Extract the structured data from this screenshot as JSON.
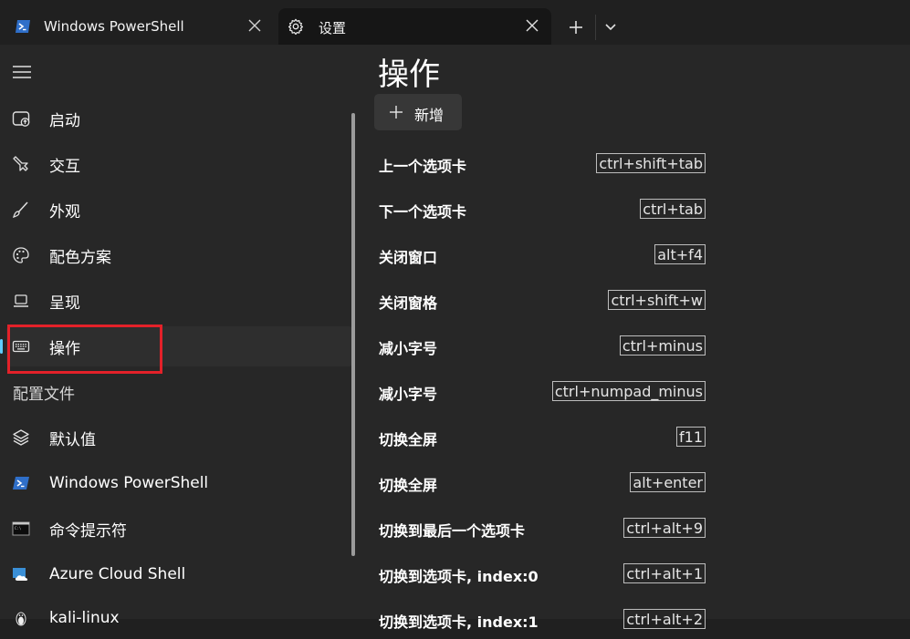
{
  "tabs": [
    {
      "title": "Windows PowerShell",
      "icon": "powershell-icon",
      "active": false
    },
    {
      "title": "设置",
      "icon": "gear-icon",
      "active": true
    }
  ],
  "sidebar": {
    "items": [
      {
        "label": "启动",
        "icon": "startup-icon"
      },
      {
        "label": "交互",
        "icon": "interaction-icon"
      },
      {
        "label": "外观",
        "icon": "brush-icon"
      },
      {
        "label": "配色方案",
        "icon": "palette-icon"
      },
      {
        "label": "呈现",
        "icon": "laptop-icon"
      },
      {
        "label": "操作",
        "icon": "keyboard-icon",
        "selected": true
      }
    ],
    "profiles_header": "配置文件",
    "profiles": [
      {
        "label": "默认值",
        "icon": "layers-icon"
      },
      {
        "label": "Windows PowerShell",
        "icon": "powershell-icon"
      },
      {
        "label": "命令提示符",
        "icon": "cmd-icon"
      },
      {
        "label": "Azure Cloud Shell",
        "icon": "azure-cloud-icon"
      },
      {
        "label": "kali-linux",
        "icon": "linux-penguin-icon"
      }
    ]
  },
  "main": {
    "title": "操作",
    "add_label": "新增",
    "actions": [
      {
        "name": "上一个选项卡",
        "key": "ctrl+shift+tab"
      },
      {
        "name": "下一个选项卡",
        "key": "ctrl+tab"
      },
      {
        "name": "关闭窗口",
        "key": "alt+f4"
      },
      {
        "name": "关闭窗格",
        "key": "ctrl+shift+w"
      },
      {
        "name": "减小字号",
        "key": "ctrl+minus"
      },
      {
        "name": "减小字号",
        "key": "ctrl+numpad_minus"
      },
      {
        "name": "切换全屏",
        "key": "f11"
      },
      {
        "name": "切换全屏",
        "key": "alt+enter"
      },
      {
        "name": "切换到最后一个选项卡",
        "key": "ctrl+alt+9"
      },
      {
        "name": "切换到选项卡, index:0",
        "key": "ctrl+alt+1"
      },
      {
        "name": "切换到选项卡, index:1",
        "key": "ctrl+alt+2"
      }
    ]
  },
  "colors": {
    "accent": "#60cdff",
    "highlight_box": "#e32129",
    "background": "#272727",
    "tabbar": "#202020"
  }
}
